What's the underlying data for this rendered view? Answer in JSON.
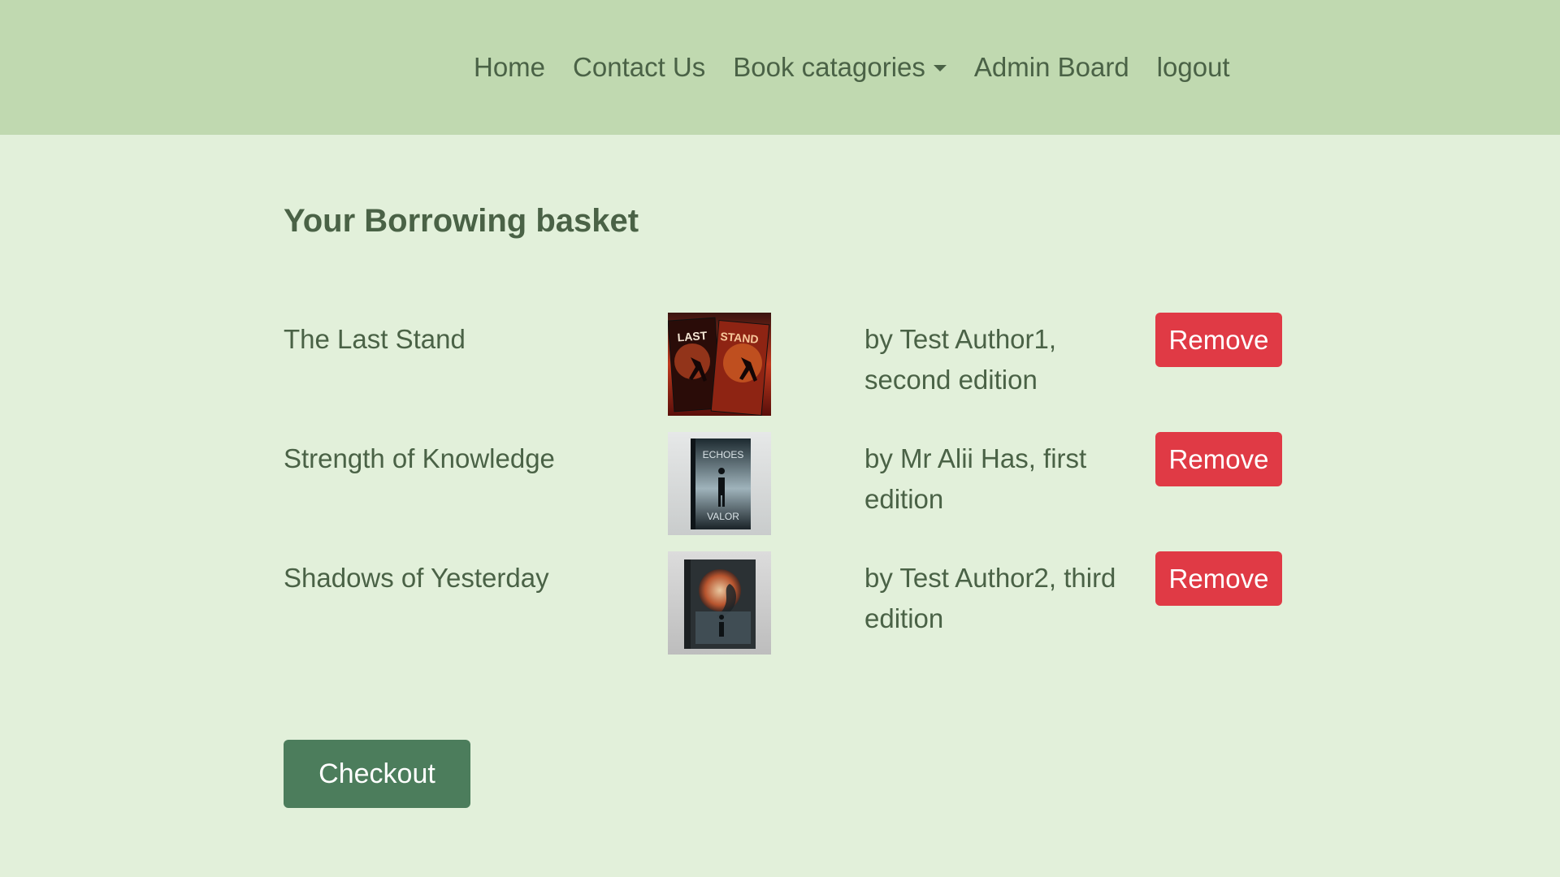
{
  "nav": {
    "home": "Home",
    "contact": "Contact Us",
    "categories": "Book catagories",
    "admin": "Admin Board",
    "logout": "logout"
  },
  "page": {
    "title": "Your Borrowing basket"
  },
  "basket": {
    "items": [
      {
        "title": "The Last Stand",
        "author": "by Test Author1, second edition",
        "remove_label": "Remove",
        "cover_lettering": "LAST STAND"
      },
      {
        "title": "Strength of Knowledge",
        "author": "by Mr Alii Has, first edition",
        "remove_label": "Remove",
        "cover_lettering": "ECHOES VALOR"
      },
      {
        "title": "Shadows of Yesterday",
        "author": "by Test Author2, third edition",
        "remove_label": "Remove",
        "cover_lettering": ""
      }
    ]
  },
  "checkout": {
    "label": "Checkout"
  },
  "colors": {
    "navbar_bg": "#c0d9b0",
    "page_bg": "#e2f0da",
    "text": "#4a6246",
    "remove_btn": "#e03a45",
    "checkout_btn": "#4c7d5c"
  }
}
